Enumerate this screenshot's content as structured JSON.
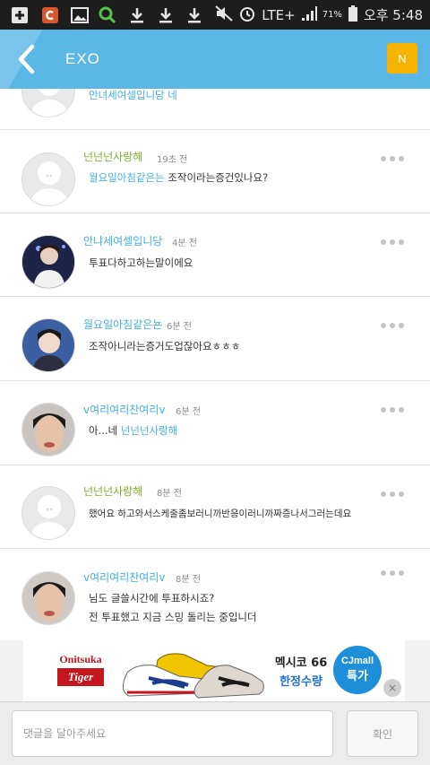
{
  "status_bar": {
    "left_icons": [
      "plus-icon",
      "c-app-icon",
      "image-icon",
      "search-icon",
      "download-icon",
      "download-icon",
      "download-icon"
    ],
    "right": {
      "battery": "71%",
      "time": "오후 5:48",
      "network": "LTE+"
    }
  },
  "app_bar": {
    "title": "EXO",
    "n_badge": "N"
  },
  "comments": [
    {
      "author": "",
      "time": "",
      "text": "안녀세여셀입니당 네",
      "mention": "",
      "avatar": "default",
      "author_color": "#43b0e6"
    },
    {
      "author": "넌넌넌사랑해",
      "time": "19초 전",
      "text": "월요일아침같은는 조작이라는증건있나요?",
      "mention": "월요일아침같은는",
      "avatar": "default",
      "author_color": "#7fb22e"
    },
    {
      "author": "안냐세여셀입니당",
      "time": "4분 전",
      "text": "투표다하고하는말이에요",
      "mention": "",
      "avatar": "photo1",
      "author_color": "#43b0e6"
    },
    {
      "author": "월요일아침같은뇬",
      "time": "6분 전",
      "text": "조작아니라는증거도업잖아요ㅎㅎㅎ",
      "mention": "",
      "avatar": "photo2",
      "author_color": "#43b0e6"
    },
    {
      "author": "v여리여리찬여리v",
      "time": "6분 전",
      "text": "아...네 ",
      "mention": "넌넌넌사랑해",
      "avatar": "photo3",
      "author_color": "#43b0e6"
    },
    {
      "author": "넌넌넌사랑해",
      "time": "8분 전",
      "text": "했어요 하고와서스케줄좀보러니까반응이러니까짜증나서그러는데요",
      "mention": "",
      "avatar": "default",
      "author_color": "#7fb22e"
    },
    {
      "author": "v여리여리찬여리v",
      "time": "8분 전",
      "text": "님도 글쓸시간에 투표하시죠?",
      "text2": "전 투표했고 지금 스밍 돌리는 중입니더",
      "mention": "",
      "avatar": "photo3",
      "author_color": "#43b0e6"
    }
  ],
  "ad": {
    "brand": "Onitsuka",
    "brand_sub": "Tiger",
    "offer_line1": "멕시코 66",
    "offer_line2": "한정수량",
    "cj_label": "CJmall",
    "cj_sub": "특가",
    "close_label": "×"
  },
  "input_bar": {
    "placeholder": "댓글을 달아주세요",
    "value": "",
    "submit_label": "확인"
  }
}
